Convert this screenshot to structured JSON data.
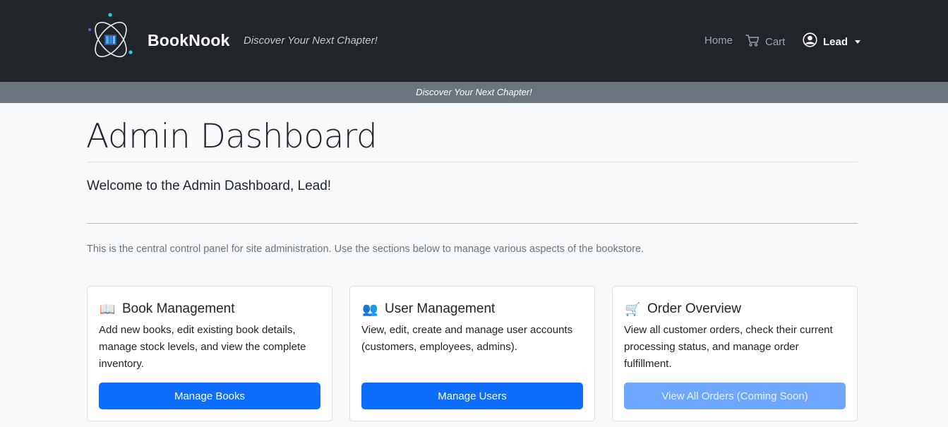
{
  "navbar": {
    "brand_name": "BookNook",
    "tagline": "Discover Your Next Chapter!",
    "links": {
      "home": "Home",
      "cart": "Cart"
    },
    "user": "Lead",
    "icons": {
      "logo": "atom-book-logo",
      "cart": "cart-icon",
      "user": "user-circle-icon"
    }
  },
  "banner": {
    "text": "Discover Your Next Chapter!"
  },
  "main": {
    "title": "Admin Dashboard",
    "welcome": "Welcome to the Admin Dashboard, Lead!",
    "intro": "This is the central control panel for site administration. Use the sections below to manage various aspects of the bookstore.",
    "cards": [
      {
        "icon": "📖",
        "title": "Book Management",
        "text": "Add new books, edit existing book details, manage stock levels, and view the complete inventory.",
        "button": "Manage Books"
      },
      {
        "icon": "👥",
        "title": "User Management",
        "text": "View, edit, create and manage user accounts (customers, employees, admins).",
        "button": "Manage Users"
      },
      {
        "icon": "🛒",
        "title": "Order Overview",
        "text": "View all customer orders, check their current processing status, and manage order fulfillment.",
        "button": "View All Orders (Coming Soon)"
      }
    ]
  },
  "colors": {
    "navbar_bg": "#212529",
    "banner_bg": "#6c757d",
    "primary": "#0d6efd",
    "primary_disabled": "#6ea8fe"
  }
}
